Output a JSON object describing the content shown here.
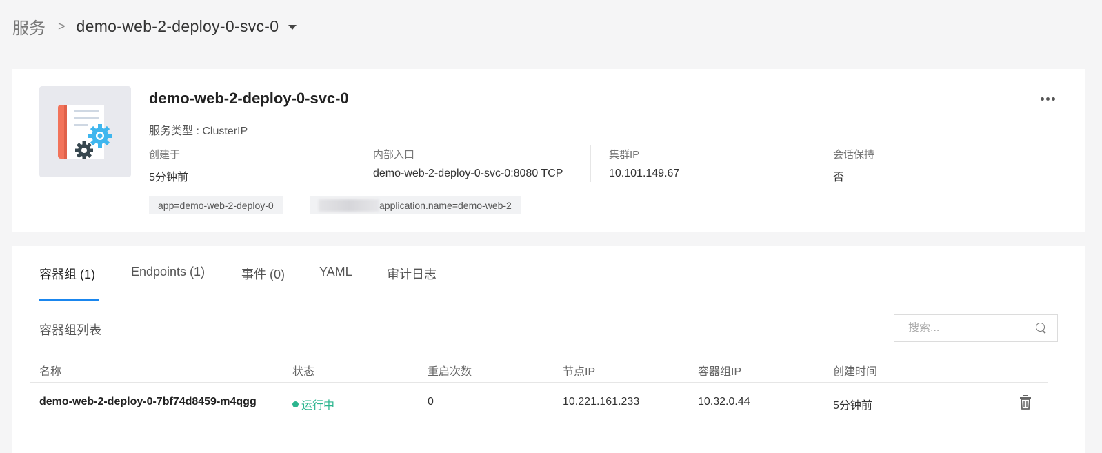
{
  "breadcrumb": {
    "root": "服务",
    "separator": ">",
    "current": "demo-web-2-deploy-0-svc-0"
  },
  "service": {
    "name": "demo-web-2-deploy-0-svc-0",
    "type_line": "服务类型 : ClusterIP",
    "meta": [
      {
        "label": "创建于",
        "value": "5分钟前"
      },
      {
        "label": "内部入口",
        "value": "demo-web-2-deploy-0-svc-0:8080 TCP"
      },
      {
        "label": "集群IP",
        "value": "10.101.149.67"
      },
      {
        "label": "会话保持",
        "value": "否"
      }
    ],
    "tags": [
      "app=demo-web-2-deploy-0",
      "application.name=demo-web-2"
    ]
  },
  "tabs": [
    {
      "label": "容器组 (1)",
      "active": true
    },
    {
      "label": "Endpoints (1)",
      "active": false
    },
    {
      "label": "事件 (0)",
      "active": false
    },
    {
      "label": "YAML",
      "active": false
    },
    {
      "label": "审计日志",
      "active": false
    }
  ],
  "pod_list": {
    "title": "容器组列表",
    "search_placeholder": "搜索...",
    "columns": [
      "名称",
      "状态",
      "重启次数",
      "节点IP",
      "容器组IP",
      "创建时间"
    ],
    "rows": [
      {
        "name": "demo-web-2-deploy-0-7bf74d8459-m4qgg",
        "status": "运行中",
        "restarts": "0",
        "node_ip": "10.221.161.233",
        "pod_ip": "10.32.0.44",
        "created": "5分钟前"
      }
    ]
  },
  "colors": {
    "accent": "#1a86ee",
    "status_running": "#2bb58e",
    "icon_book": "#f2735a",
    "icon_gear_light": "#3fb6ee",
    "icon_gear_dark": "#37474f"
  }
}
